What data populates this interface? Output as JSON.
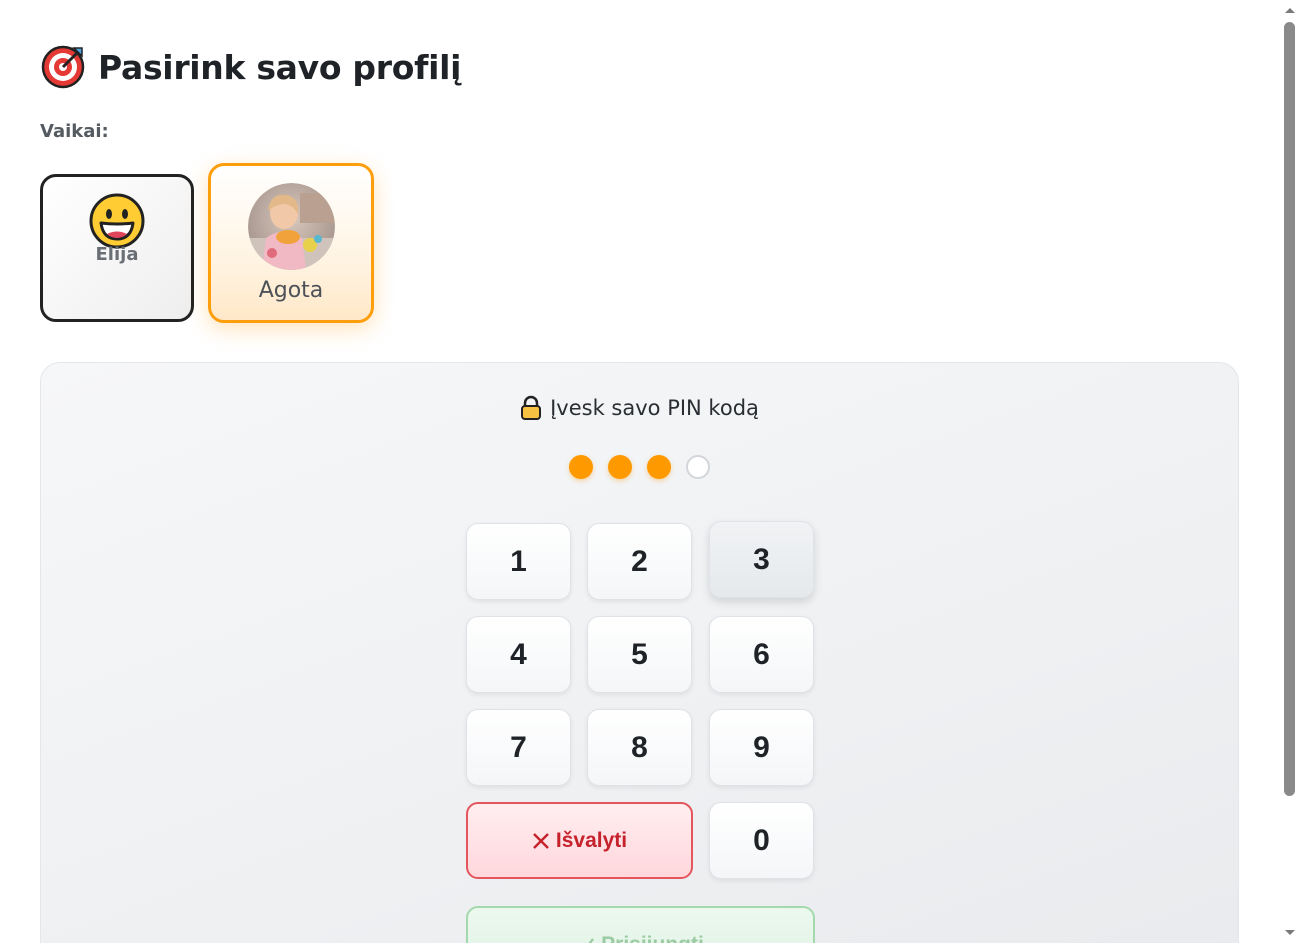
{
  "header": {
    "icon": "target-dart-icon",
    "title": "Pasirink savo profilį"
  },
  "profiles": {
    "section_label": "Vaikai:",
    "items": [
      {
        "name": "Elija",
        "avatar": "grinning-face-emoji",
        "selected": false
      },
      {
        "name": "Agota",
        "avatar": "photo",
        "selected": true
      }
    ]
  },
  "pin": {
    "title": "Įvesk savo PIN kodą",
    "icon": "lock-icon",
    "entered_count": 3,
    "total_digits": 4,
    "keys": [
      "1",
      "2",
      "3",
      "4",
      "5",
      "6",
      "7",
      "8",
      "9",
      "0"
    ],
    "clear_label": "Išvalyti",
    "login_label": "Prisijungti"
  },
  "colors": {
    "accent": "#ff9900",
    "selected_border": "#ff9e0d",
    "clear_border": "#e4555d",
    "clear_text": "#c5222c",
    "login_border": "#a3d9ad"
  }
}
